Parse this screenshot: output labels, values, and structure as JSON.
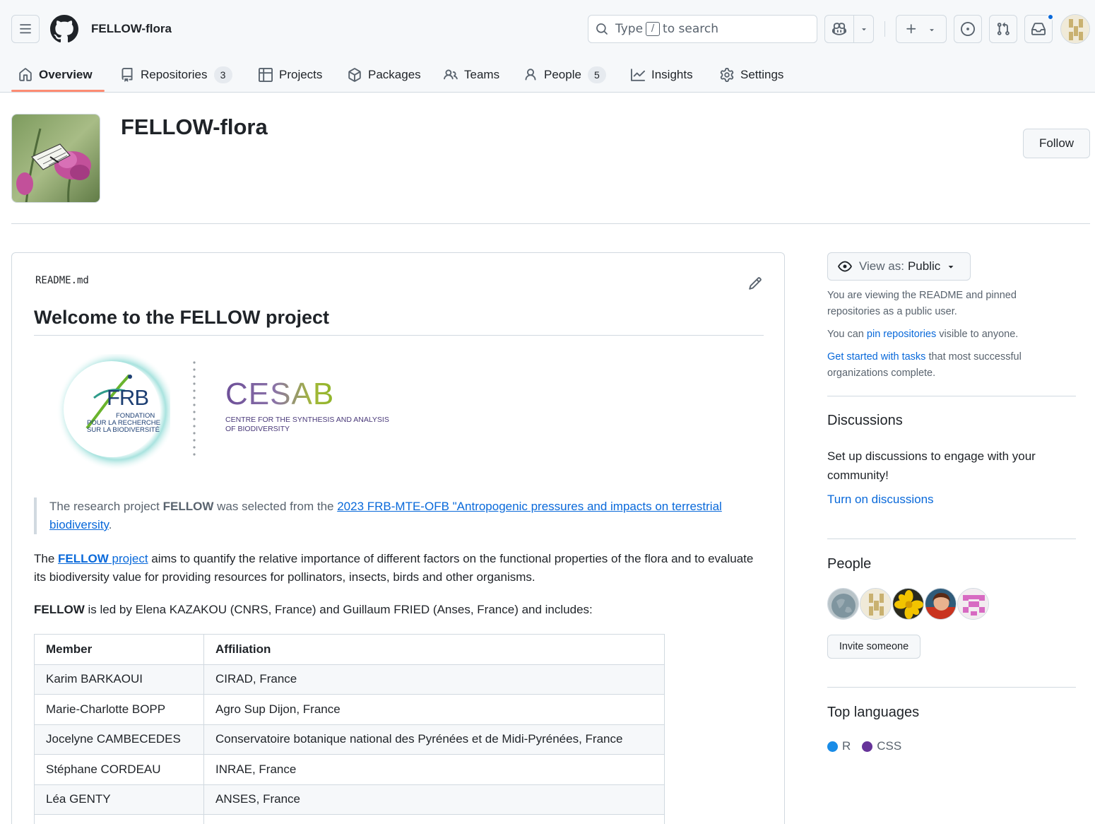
{
  "header": {
    "org_name": "FELLOW-flora",
    "search": {
      "prefix": "Type",
      "key": "/",
      "suffix": "to search"
    }
  },
  "tabs": [
    {
      "label": "Overview",
      "icon": "home-icon"
    },
    {
      "label": "Repositories",
      "count": "3",
      "icon": "repo-icon"
    },
    {
      "label": "Projects",
      "icon": "table-icon"
    },
    {
      "label": "Packages",
      "icon": "package-icon"
    },
    {
      "label": "Teams",
      "icon": "people-icon"
    },
    {
      "label": "People",
      "count": "5",
      "icon": "person-icon"
    },
    {
      "label": "Insights",
      "icon": "graph-icon"
    },
    {
      "label": "Settings",
      "icon": "gear-icon"
    }
  ],
  "org": {
    "title": "FELLOW-flora",
    "follow_label": "Follow"
  },
  "readme": {
    "filename": "README.md",
    "heading": "Welcome to the FELLOW project",
    "frb_logo": {
      "brand": "FRB",
      "line1": "FONDATION",
      "line2": "POUR LA RECHERCHE",
      "line3": "SUR LA BIODIVERSITÉ"
    },
    "cesab_logo": {
      "brand": "CESAB",
      "line1": "CENTRE FOR THE SYNTHESIS AND ANALYSIS",
      "line2": "OF BIODIVERSITY"
    },
    "quote": {
      "pre": "The research project ",
      "bold": "FELLOW",
      "mid": " was selected from the ",
      "link": "2023 FRB-MTE-OFB \"Antropogenic pressures and impacts on terrestrial biodiversity",
      "post": "."
    },
    "para1": {
      "pre": "The ",
      "link_bold": "FELLOW",
      "link_rest": " project",
      "post": " aims to quantify the relative importance of different factors on the functional properties of the flora and to evaluate its biodiversity value for providing resources for pollinators, insects, birds and other organisms."
    },
    "para2": {
      "bold": "FELLOW",
      "post": " is led by Elena KAZAKOU (CNRS, France) and Guillaum FRIED (Anses, France) and includes:"
    },
    "table": {
      "headers": [
        "Member",
        "Affiliation"
      ],
      "rows": [
        [
          "Karim BARKAOUI",
          "CIRAD, France"
        ],
        [
          "Marie-Charlotte BOPP",
          "Agro Sup Dijon, France"
        ],
        [
          "Jocelyne CAMBECEDES",
          "Conservatoire botanique national des Pyrénées et de Midi-Pyrénées, France"
        ],
        [
          "Stéphane CORDEAU",
          "INRAE, France"
        ],
        [
          "Léa GENTY",
          "ANSES, France"
        ],
        [
          "",
          ""
        ]
      ]
    }
  },
  "sidebar": {
    "view_as_label": "View as:",
    "view_as_value": "Public",
    "note1": "You are viewing the README and pinned repositories as a public user.",
    "note2_pre": "You can ",
    "note2_link": "pin repositories",
    "note2_post": " visible to anyone.",
    "note3_link": "Get started with tasks",
    "note3_post": " that most successful organizations complete.",
    "discussions_title": "Discussions",
    "discussions_text": "Set up discussions to engage with your community!",
    "discussions_link": "Turn on discussions",
    "people_title": "People",
    "invite_label": "Invite someone",
    "languages_title": "Top languages",
    "languages": [
      {
        "name": "R",
        "color": "#198ce7"
      },
      {
        "name": "CSS",
        "color": "#663399"
      }
    ]
  }
}
